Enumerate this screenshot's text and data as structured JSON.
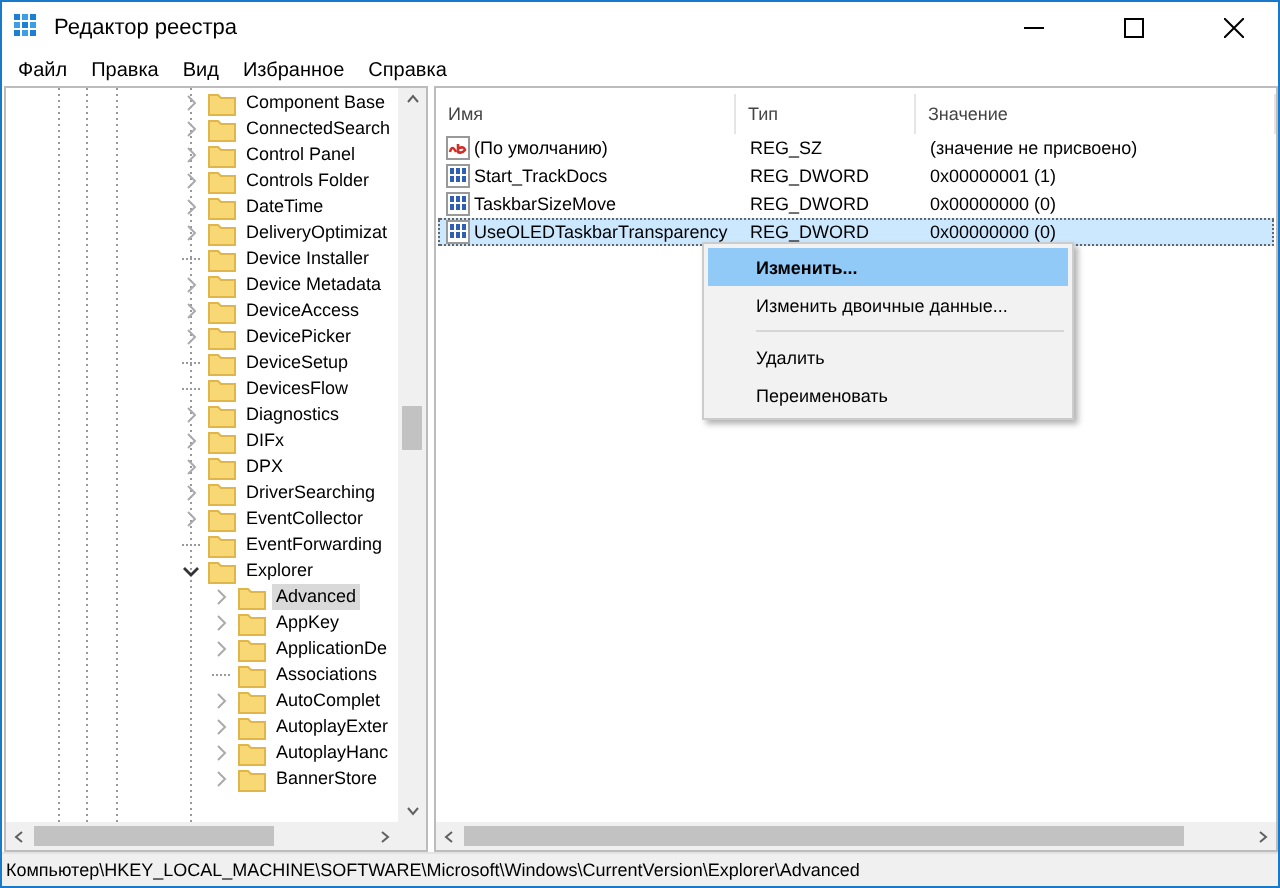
{
  "window": {
    "title": "Редактор реестра"
  },
  "menu": [
    "Файл",
    "Правка",
    "Вид",
    "Избранное",
    "Справка"
  ],
  "tree": {
    "items": [
      {
        "label": "Component Base",
        "kind": "branch",
        "expanded": false,
        "selected": false
      },
      {
        "label": "ConnectedSearch",
        "kind": "branch",
        "expanded": false,
        "selected": false
      },
      {
        "label": "Control Panel",
        "kind": "branch",
        "expanded": false,
        "selected": false
      },
      {
        "label": "Controls Folder",
        "kind": "branch",
        "expanded": false,
        "selected": false
      },
      {
        "label": "DateTime",
        "kind": "branch",
        "expanded": false,
        "selected": false
      },
      {
        "label": "DeliveryOptimizat",
        "kind": "branch",
        "expanded": false,
        "selected": false
      },
      {
        "label": "Device Installer",
        "kind": "leaf",
        "selected": false
      },
      {
        "label": "Device Metadata",
        "kind": "branch",
        "expanded": false,
        "selected": false
      },
      {
        "label": "DeviceAccess",
        "kind": "branch",
        "expanded": false,
        "selected": false
      },
      {
        "label": "DevicePicker",
        "kind": "branch",
        "expanded": false,
        "selected": false
      },
      {
        "label": "DeviceSetup",
        "kind": "leaf",
        "selected": false
      },
      {
        "label": "DevicesFlow",
        "kind": "leaf",
        "selected": false
      },
      {
        "label": "Diagnostics",
        "kind": "branch",
        "expanded": false,
        "selected": false
      },
      {
        "label": "DIFx",
        "kind": "branch",
        "expanded": false,
        "selected": false
      },
      {
        "label": "DPX",
        "kind": "branch",
        "expanded": false,
        "selected": false
      },
      {
        "label": "DriverSearching",
        "kind": "branch",
        "expanded": false,
        "selected": false
      },
      {
        "label": "EventCollector",
        "kind": "branch",
        "expanded": false,
        "selected": false
      },
      {
        "label": "EventForwarding",
        "kind": "leaf",
        "selected": false
      },
      {
        "label": "Explorer",
        "kind": "branch",
        "expanded": true,
        "selected": false,
        "children": [
          {
            "label": "Advanced",
            "kind": "branch",
            "expanded": false,
            "selected": true
          },
          {
            "label": "AppKey",
            "kind": "branch",
            "expanded": false,
            "selected": false
          },
          {
            "label": "ApplicationDe",
            "kind": "branch",
            "expanded": false,
            "selected": false
          },
          {
            "label": "Associations",
            "kind": "leaf",
            "selected": false
          },
          {
            "label": "AutoComplet",
            "kind": "branch",
            "expanded": false,
            "selected": false
          },
          {
            "label": "AutoplayExter",
            "kind": "branch",
            "expanded": false,
            "selected": false
          },
          {
            "label": "AutoplayHanc",
            "kind": "branch",
            "expanded": false,
            "selected": false
          },
          {
            "label": "BannerStore",
            "kind": "branch",
            "expanded": false,
            "selected": false
          }
        ]
      }
    ]
  },
  "values": {
    "columns": [
      "Имя",
      "Тип",
      "Значение"
    ],
    "rows": [
      {
        "kind": "string",
        "name": "(По умолчанию)",
        "type": "REG_SZ",
        "data": "(значение не присвоено)",
        "selected": false
      },
      {
        "kind": "dword",
        "name": "Start_TrackDocs",
        "type": "REG_DWORD",
        "data": "0x00000001 (1)",
        "selected": false
      },
      {
        "kind": "dword",
        "name": "TaskbarSizeMove",
        "type": "REG_DWORD",
        "data": "0x00000000 (0)",
        "selected": false
      },
      {
        "kind": "dword",
        "name": "UseOLEDTaskbarTransparency",
        "type": "REG_DWORD",
        "data": "0x00000000 (0)",
        "selected": true
      }
    ]
  },
  "context_menu": {
    "items": [
      {
        "kind": "item",
        "label": "Изменить...",
        "default": true,
        "selected": true
      },
      {
        "kind": "item",
        "label": "Изменить двоичные данные...",
        "default": false,
        "selected": false
      },
      {
        "kind": "separator"
      },
      {
        "kind": "item",
        "label": "Удалить",
        "default": false,
        "selected": false
      },
      {
        "kind": "item",
        "label": "Переименовать",
        "default": false,
        "selected": false
      }
    ]
  },
  "status_bar": "Компьютер\\HKEY_LOCAL_MACHINE\\SOFTWARE\\Microsoft\\Windows\\CurrentVersion\\Explorer\\Advanced"
}
